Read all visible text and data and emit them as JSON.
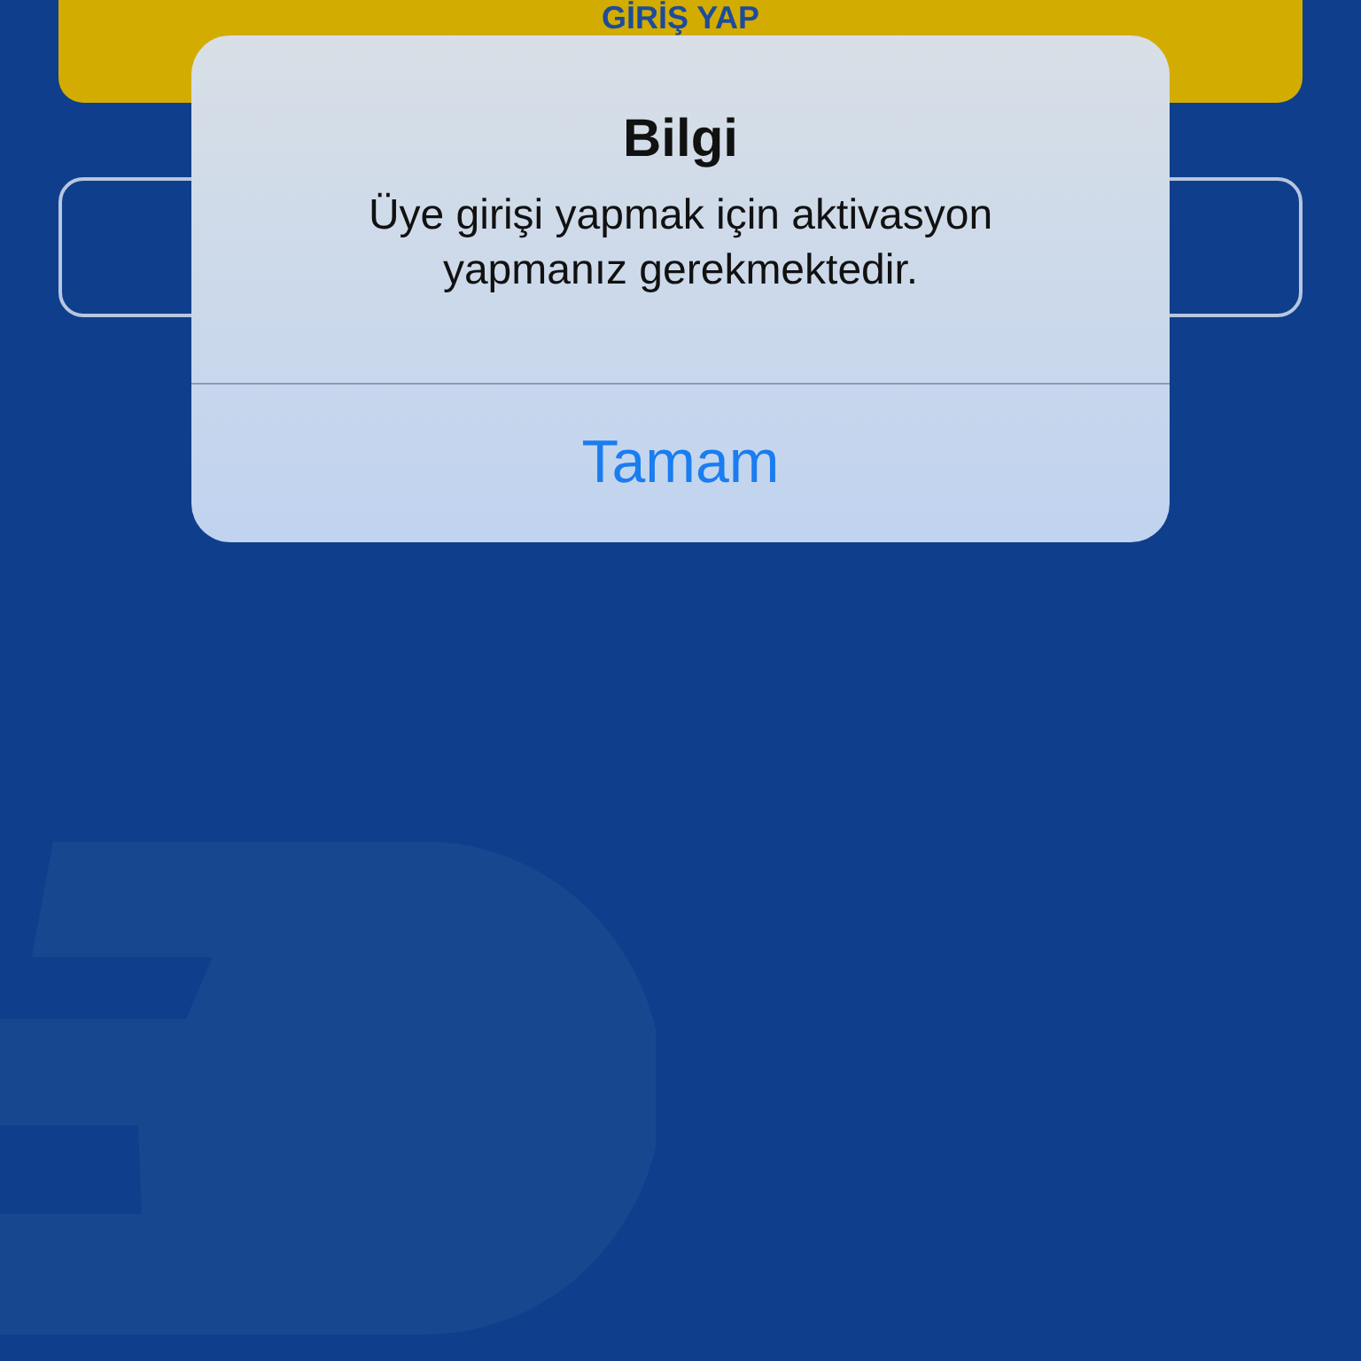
{
  "login_button": {
    "label": "GİRİŞ YAP"
  },
  "alert": {
    "title": "Bilgi",
    "message": "Üye girişi yapmak için aktivasyon yapmanız gerekmektedir.",
    "actions": [
      "Tamam"
    ]
  }
}
